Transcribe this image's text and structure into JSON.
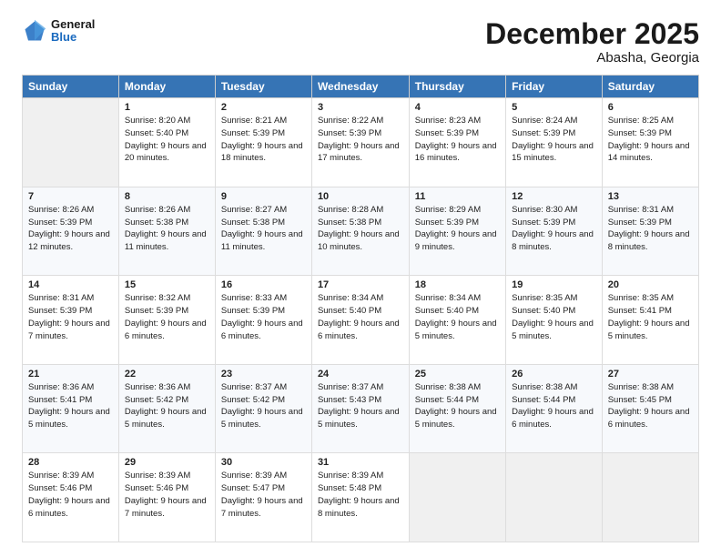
{
  "header": {
    "logo_general": "General",
    "logo_blue": "Blue",
    "title": "December 2025",
    "subtitle": "Abasha, Georgia"
  },
  "weekdays": [
    "Sunday",
    "Monday",
    "Tuesday",
    "Wednesday",
    "Thursday",
    "Friday",
    "Saturday"
  ],
  "weeks": [
    [
      {
        "day": "",
        "sunrise": "",
        "sunset": "",
        "daylight": "",
        "empty": true
      },
      {
        "day": "1",
        "sunrise": "Sunrise: 8:20 AM",
        "sunset": "Sunset: 5:40 PM",
        "daylight": "Daylight: 9 hours and 20 minutes."
      },
      {
        "day": "2",
        "sunrise": "Sunrise: 8:21 AM",
        "sunset": "Sunset: 5:39 PM",
        "daylight": "Daylight: 9 hours and 18 minutes."
      },
      {
        "day": "3",
        "sunrise": "Sunrise: 8:22 AM",
        "sunset": "Sunset: 5:39 PM",
        "daylight": "Daylight: 9 hours and 17 minutes."
      },
      {
        "day": "4",
        "sunrise": "Sunrise: 8:23 AM",
        "sunset": "Sunset: 5:39 PM",
        "daylight": "Daylight: 9 hours and 16 minutes."
      },
      {
        "day": "5",
        "sunrise": "Sunrise: 8:24 AM",
        "sunset": "Sunset: 5:39 PM",
        "daylight": "Daylight: 9 hours and 15 minutes."
      },
      {
        "day": "6",
        "sunrise": "Sunrise: 8:25 AM",
        "sunset": "Sunset: 5:39 PM",
        "daylight": "Daylight: 9 hours and 14 minutes."
      }
    ],
    [
      {
        "day": "7",
        "sunrise": "Sunrise: 8:26 AM",
        "sunset": "Sunset: 5:39 PM",
        "daylight": "Daylight: 9 hours and 12 minutes."
      },
      {
        "day": "8",
        "sunrise": "Sunrise: 8:26 AM",
        "sunset": "Sunset: 5:38 PM",
        "daylight": "Daylight: 9 hours and 11 minutes."
      },
      {
        "day": "9",
        "sunrise": "Sunrise: 8:27 AM",
        "sunset": "Sunset: 5:38 PM",
        "daylight": "Daylight: 9 hours and 11 minutes."
      },
      {
        "day": "10",
        "sunrise": "Sunrise: 8:28 AM",
        "sunset": "Sunset: 5:38 PM",
        "daylight": "Daylight: 9 hours and 10 minutes."
      },
      {
        "day": "11",
        "sunrise": "Sunrise: 8:29 AM",
        "sunset": "Sunset: 5:39 PM",
        "daylight": "Daylight: 9 hours and 9 minutes."
      },
      {
        "day": "12",
        "sunrise": "Sunrise: 8:30 AM",
        "sunset": "Sunset: 5:39 PM",
        "daylight": "Daylight: 9 hours and 8 minutes."
      },
      {
        "day": "13",
        "sunrise": "Sunrise: 8:31 AM",
        "sunset": "Sunset: 5:39 PM",
        "daylight": "Daylight: 9 hours and 8 minutes."
      }
    ],
    [
      {
        "day": "14",
        "sunrise": "Sunrise: 8:31 AM",
        "sunset": "Sunset: 5:39 PM",
        "daylight": "Daylight: 9 hours and 7 minutes."
      },
      {
        "day": "15",
        "sunrise": "Sunrise: 8:32 AM",
        "sunset": "Sunset: 5:39 PM",
        "daylight": "Daylight: 9 hours and 6 minutes."
      },
      {
        "day": "16",
        "sunrise": "Sunrise: 8:33 AM",
        "sunset": "Sunset: 5:39 PM",
        "daylight": "Daylight: 9 hours and 6 minutes."
      },
      {
        "day": "17",
        "sunrise": "Sunrise: 8:34 AM",
        "sunset": "Sunset: 5:40 PM",
        "daylight": "Daylight: 9 hours and 6 minutes."
      },
      {
        "day": "18",
        "sunrise": "Sunrise: 8:34 AM",
        "sunset": "Sunset: 5:40 PM",
        "daylight": "Daylight: 9 hours and 5 minutes."
      },
      {
        "day": "19",
        "sunrise": "Sunrise: 8:35 AM",
        "sunset": "Sunset: 5:40 PM",
        "daylight": "Daylight: 9 hours and 5 minutes."
      },
      {
        "day": "20",
        "sunrise": "Sunrise: 8:35 AM",
        "sunset": "Sunset: 5:41 PM",
        "daylight": "Daylight: 9 hours and 5 minutes."
      }
    ],
    [
      {
        "day": "21",
        "sunrise": "Sunrise: 8:36 AM",
        "sunset": "Sunset: 5:41 PM",
        "daylight": "Daylight: 9 hours and 5 minutes."
      },
      {
        "day": "22",
        "sunrise": "Sunrise: 8:36 AM",
        "sunset": "Sunset: 5:42 PM",
        "daylight": "Daylight: 9 hours and 5 minutes."
      },
      {
        "day": "23",
        "sunrise": "Sunrise: 8:37 AM",
        "sunset": "Sunset: 5:42 PM",
        "daylight": "Daylight: 9 hours and 5 minutes."
      },
      {
        "day": "24",
        "sunrise": "Sunrise: 8:37 AM",
        "sunset": "Sunset: 5:43 PM",
        "daylight": "Daylight: 9 hours and 5 minutes."
      },
      {
        "day": "25",
        "sunrise": "Sunrise: 8:38 AM",
        "sunset": "Sunset: 5:44 PM",
        "daylight": "Daylight: 9 hours and 5 minutes."
      },
      {
        "day": "26",
        "sunrise": "Sunrise: 8:38 AM",
        "sunset": "Sunset: 5:44 PM",
        "daylight": "Daylight: 9 hours and 6 minutes."
      },
      {
        "day": "27",
        "sunrise": "Sunrise: 8:38 AM",
        "sunset": "Sunset: 5:45 PM",
        "daylight": "Daylight: 9 hours and 6 minutes."
      }
    ],
    [
      {
        "day": "28",
        "sunrise": "Sunrise: 8:39 AM",
        "sunset": "Sunset: 5:46 PM",
        "daylight": "Daylight: 9 hours and 6 minutes."
      },
      {
        "day": "29",
        "sunrise": "Sunrise: 8:39 AM",
        "sunset": "Sunset: 5:46 PM",
        "daylight": "Daylight: 9 hours and 7 minutes."
      },
      {
        "day": "30",
        "sunrise": "Sunrise: 8:39 AM",
        "sunset": "Sunset: 5:47 PM",
        "daylight": "Daylight: 9 hours and 7 minutes."
      },
      {
        "day": "31",
        "sunrise": "Sunrise: 8:39 AM",
        "sunset": "Sunset: 5:48 PM",
        "daylight": "Daylight: 9 hours and 8 minutes."
      },
      {
        "day": "",
        "sunrise": "",
        "sunset": "",
        "daylight": "",
        "empty": true
      },
      {
        "day": "",
        "sunrise": "",
        "sunset": "",
        "daylight": "",
        "empty": true
      },
      {
        "day": "",
        "sunrise": "",
        "sunset": "",
        "daylight": "",
        "empty": true
      }
    ]
  ]
}
